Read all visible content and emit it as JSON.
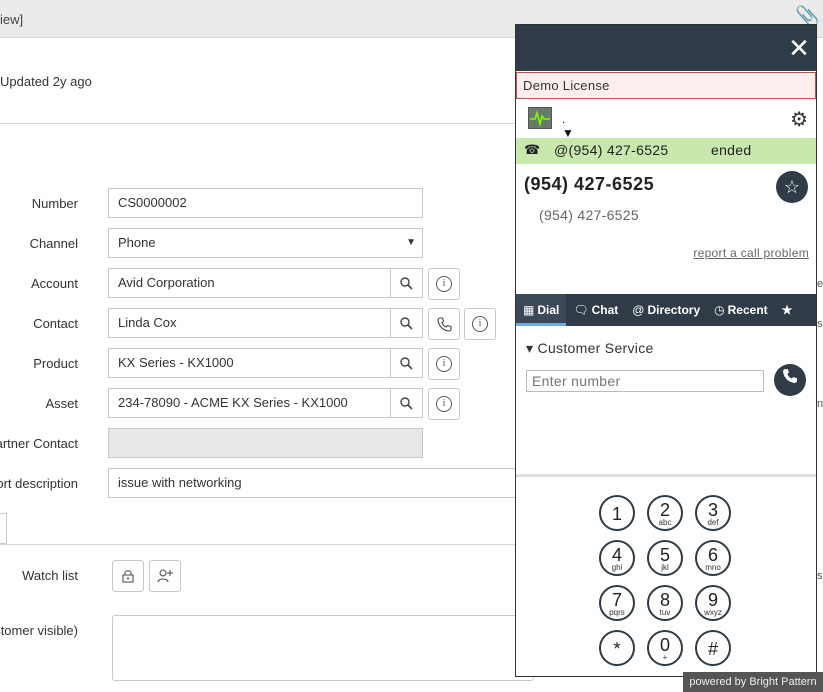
{
  "topbar": {
    "crumb": "iew]",
    "attach_icon": "paperclip-icon"
  },
  "header": {
    "updated": "Updated 2y ago"
  },
  "form": {
    "number_label": "Number",
    "number_value": "CS0000002",
    "channel_label": "Channel",
    "channel_value": "Phone",
    "account_label": "Account",
    "account_value": "Avid Corporation",
    "contact_label": "Contact",
    "contact_value": "Linda Cox",
    "product_label": "Product",
    "product_value": "KX Series - KX1000",
    "asset_label": "Asset",
    "asset_value": "234-78090 - ACME KX Series - KX1000",
    "partner_label": "artner Contact",
    "partner_value": "",
    "short_desc_label": "ort description",
    "short_desc_value": "issue with networking",
    "watch_label": "Watch list",
    "comments_label": "ustomer visible)"
  },
  "softphone": {
    "license": "Demo License",
    "status_indicator": ".",
    "call_number": "@(954) 427-6525",
    "call_state": "ended",
    "big_number": "(954) 427-6525",
    "small_number": "(954) 427-6525",
    "report_link": "report a call problem",
    "tabs": [
      "Dial",
      "Chat",
      "Directory",
      "Recent"
    ],
    "section": "Customer Service",
    "input_placeholder": "Enter number",
    "keys": [
      {
        "d": "1",
        "l": ""
      },
      {
        "d": "2",
        "l": "abc"
      },
      {
        "d": "3",
        "l": "def"
      },
      {
        "d": "4",
        "l": "ghi"
      },
      {
        "d": "5",
        "l": "jkl"
      },
      {
        "d": "6",
        "l": "mno"
      },
      {
        "d": "7",
        "l": "pqrs"
      },
      {
        "d": "8",
        "l": "tuv"
      },
      {
        "d": "9",
        "l": "wxyz"
      },
      {
        "d": "*",
        "l": ""
      },
      {
        "d": "0",
        "l": "+"
      },
      {
        "d": "#",
        "l": ""
      }
    ],
    "powered": "powered by Bright Pattern"
  },
  "right_edge": {
    "a": "e",
    "b": "s",
    "c": "nt",
    "d": "s"
  }
}
